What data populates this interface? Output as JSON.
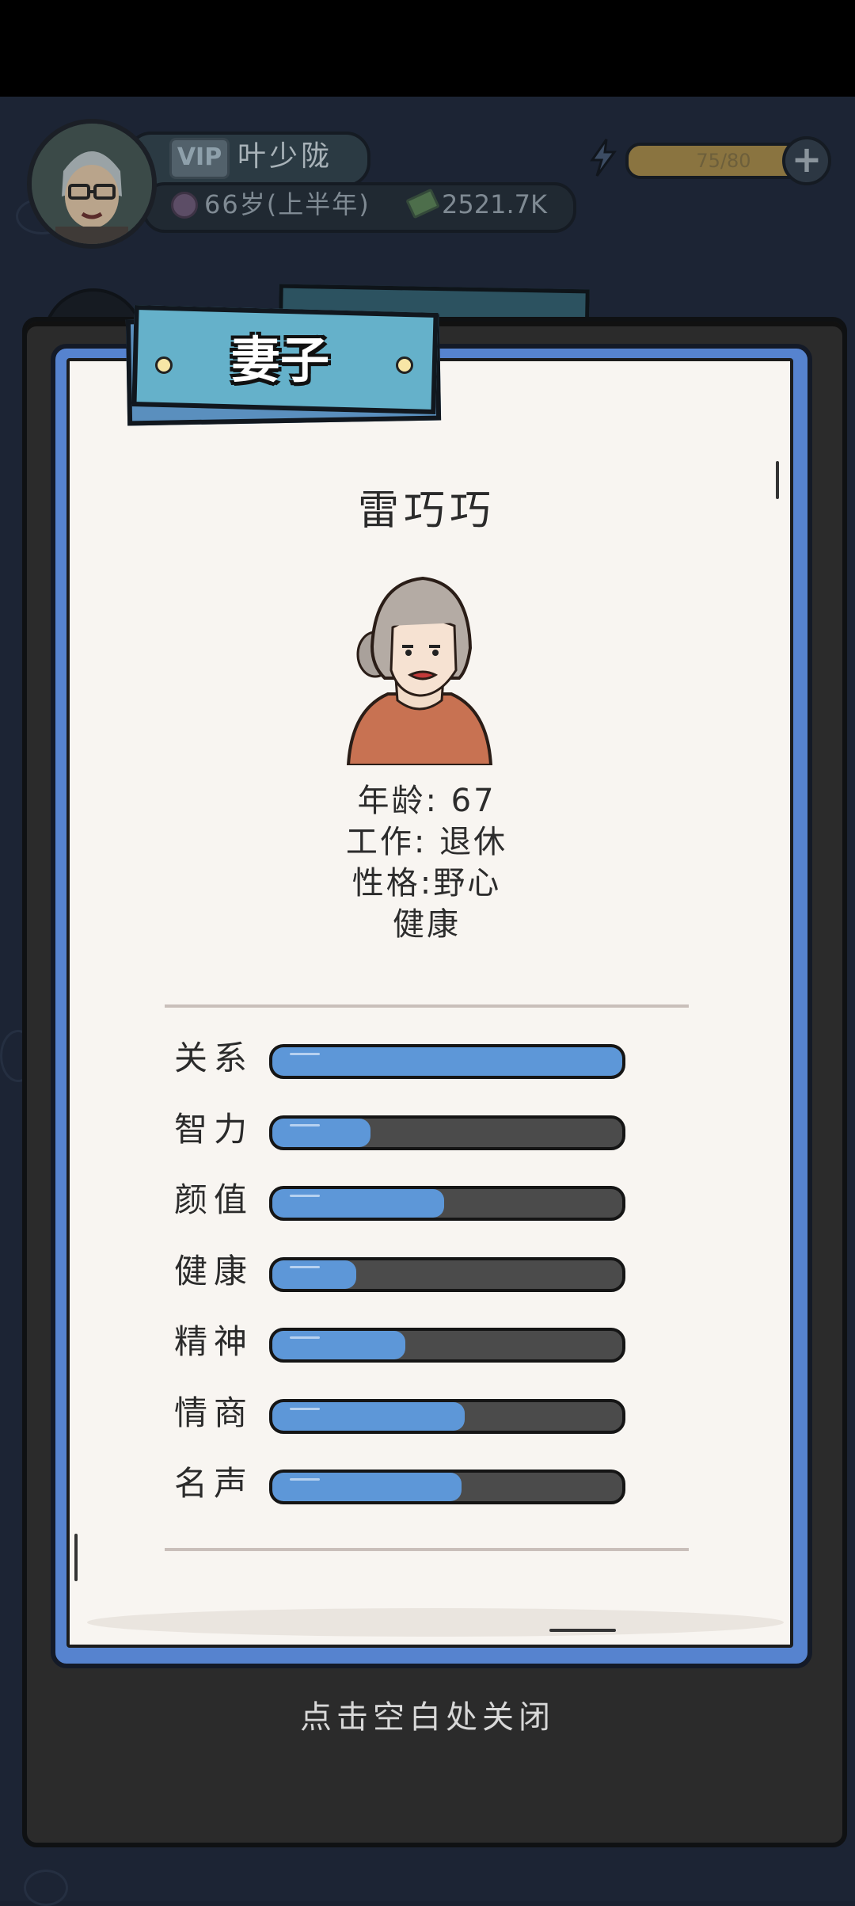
{
  "hud": {
    "vip_label": "VIP",
    "player_name": "叶少陇",
    "age_text": "66岁(上半年)",
    "money_text": "2521.7K",
    "energy_text": "75/80",
    "energy_level": 0.94,
    "plus_label": "+"
  },
  "panel": {
    "title": "妻子",
    "person_name": "雷巧巧",
    "age_line": "年龄: 67",
    "job_line": "工作: 退休",
    "personality_line": "性格:野心",
    "health_line": "健康"
  },
  "stats": [
    {
      "label": "关系",
      "value": 1.0
    },
    {
      "label": "智力",
      "value": 0.28
    },
    {
      "label": "颜值",
      "value": 0.49
    },
    {
      "label": "健康",
      "value": 0.24
    },
    {
      "label": "精神",
      "value": 0.38
    },
    {
      "label": "情商",
      "value": 0.55
    },
    {
      "label": "名声",
      "value": 0.54
    }
  ],
  "close_hint": "点击空白处关闭",
  "colors": {
    "stat_fill": "#5d97d8",
    "panel_blue": "#5683cf",
    "banner": "#65b1ca"
  }
}
